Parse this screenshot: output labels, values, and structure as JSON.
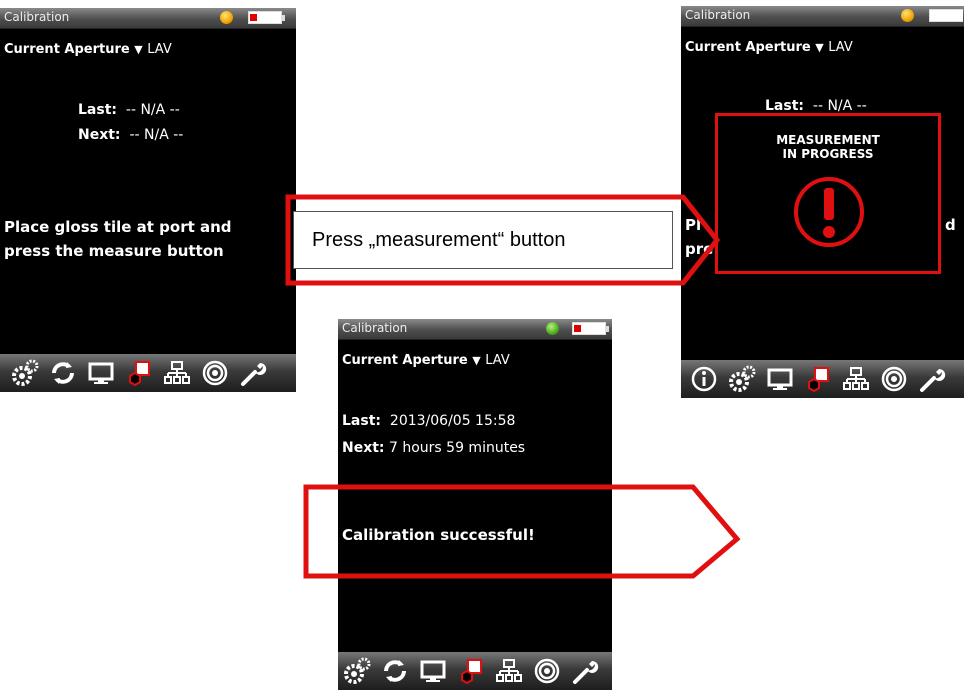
{
  "screen_left": {
    "title": "Calibration",
    "aperture_label": "Current Aperture",
    "aperture_arrow": "▼",
    "aperture_value": "LAV",
    "last_label": "Last:",
    "last_value": "-- N/A --",
    "next_label": "Next:",
    "next_value": "-- N/A --",
    "message_line1": "Place gloss tile at port and",
    "message_line2": "press the measure button",
    "toolbar_icons": [
      "gears-icon",
      "refresh-icon",
      "monitor-icon",
      "calibration-icon",
      "network-icon",
      "target-icon",
      "wrench-icon"
    ]
  },
  "screen_right": {
    "title": "Calibration",
    "aperture_label": "Current Aperture",
    "aperture_arrow": "▼",
    "aperture_value": "LAV",
    "last_label": "Last:",
    "last_value": "-- N/A --",
    "message_fragment_left_1": "Pl",
    "message_fragment_left_2": "pre",
    "message_fragment_right": "d",
    "overlay_line1": "MEASUREMENT",
    "overlay_line2": "IN PROGRESS",
    "toolbar_icons": [
      "info-icon",
      "gears-icon",
      "monitor-icon",
      "calibration-icon",
      "network-icon",
      "target-icon",
      "wrench-icon"
    ]
  },
  "screen_bottom": {
    "title": "Calibration",
    "aperture_label": "Current Aperture",
    "aperture_arrow": "▼",
    "aperture_value": "LAV",
    "last_label": "Last:",
    "last_value": "2013/06/05 15:58",
    "next_label": "Next:",
    "next_value": "7 hours 59 minutes",
    "message": "Calibration successful!",
    "toolbar_icons": [
      "gears-icon",
      "refresh-icon",
      "monitor-icon",
      "calibration-icon",
      "network-icon",
      "target-icon",
      "wrench-icon"
    ]
  },
  "callout_press": "Press „measurement“ button",
  "colors": {
    "callout_red": "#e01010",
    "screen_background": "#000000",
    "led_orange": "#f2a400",
    "led_green": "#4fae1f"
  }
}
